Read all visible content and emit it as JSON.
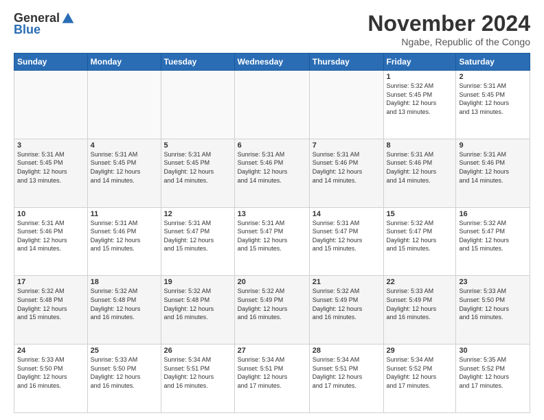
{
  "logo": {
    "general": "General",
    "blue": "Blue"
  },
  "title": "November 2024",
  "location": "Ngabe, Republic of the Congo",
  "days_of_week": [
    "Sunday",
    "Monday",
    "Tuesday",
    "Wednesday",
    "Thursday",
    "Friday",
    "Saturday"
  ],
  "weeks": [
    [
      {
        "day": "",
        "info": ""
      },
      {
        "day": "",
        "info": ""
      },
      {
        "day": "",
        "info": ""
      },
      {
        "day": "",
        "info": ""
      },
      {
        "day": "",
        "info": ""
      },
      {
        "day": "1",
        "info": "Sunrise: 5:32 AM\nSunset: 5:45 PM\nDaylight: 12 hours\nand 13 minutes."
      },
      {
        "day": "2",
        "info": "Sunrise: 5:31 AM\nSunset: 5:45 PM\nDaylight: 12 hours\nand 13 minutes."
      }
    ],
    [
      {
        "day": "3",
        "info": "Sunrise: 5:31 AM\nSunset: 5:45 PM\nDaylight: 12 hours\nand 13 minutes."
      },
      {
        "day": "4",
        "info": "Sunrise: 5:31 AM\nSunset: 5:45 PM\nDaylight: 12 hours\nand 14 minutes."
      },
      {
        "day": "5",
        "info": "Sunrise: 5:31 AM\nSunset: 5:45 PM\nDaylight: 12 hours\nand 14 minutes."
      },
      {
        "day": "6",
        "info": "Sunrise: 5:31 AM\nSunset: 5:46 PM\nDaylight: 12 hours\nand 14 minutes."
      },
      {
        "day": "7",
        "info": "Sunrise: 5:31 AM\nSunset: 5:46 PM\nDaylight: 12 hours\nand 14 minutes."
      },
      {
        "day": "8",
        "info": "Sunrise: 5:31 AM\nSunset: 5:46 PM\nDaylight: 12 hours\nand 14 minutes."
      },
      {
        "day": "9",
        "info": "Sunrise: 5:31 AM\nSunset: 5:46 PM\nDaylight: 12 hours\nand 14 minutes."
      }
    ],
    [
      {
        "day": "10",
        "info": "Sunrise: 5:31 AM\nSunset: 5:46 PM\nDaylight: 12 hours\nand 14 minutes."
      },
      {
        "day": "11",
        "info": "Sunrise: 5:31 AM\nSunset: 5:46 PM\nDaylight: 12 hours\nand 15 minutes."
      },
      {
        "day": "12",
        "info": "Sunrise: 5:31 AM\nSunset: 5:47 PM\nDaylight: 12 hours\nand 15 minutes."
      },
      {
        "day": "13",
        "info": "Sunrise: 5:31 AM\nSunset: 5:47 PM\nDaylight: 12 hours\nand 15 minutes."
      },
      {
        "day": "14",
        "info": "Sunrise: 5:31 AM\nSunset: 5:47 PM\nDaylight: 12 hours\nand 15 minutes."
      },
      {
        "day": "15",
        "info": "Sunrise: 5:32 AM\nSunset: 5:47 PM\nDaylight: 12 hours\nand 15 minutes."
      },
      {
        "day": "16",
        "info": "Sunrise: 5:32 AM\nSunset: 5:47 PM\nDaylight: 12 hours\nand 15 minutes."
      }
    ],
    [
      {
        "day": "17",
        "info": "Sunrise: 5:32 AM\nSunset: 5:48 PM\nDaylight: 12 hours\nand 15 minutes."
      },
      {
        "day": "18",
        "info": "Sunrise: 5:32 AM\nSunset: 5:48 PM\nDaylight: 12 hours\nand 16 minutes."
      },
      {
        "day": "19",
        "info": "Sunrise: 5:32 AM\nSunset: 5:48 PM\nDaylight: 12 hours\nand 16 minutes."
      },
      {
        "day": "20",
        "info": "Sunrise: 5:32 AM\nSunset: 5:49 PM\nDaylight: 12 hours\nand 16 minutes."
      },
      {
        "day": "21",
        "info": "Sunrise: 5:32 AM\nSunset: 5:49 PM\nDaylight: 12 hours\nand 16 minutes."
      },
      {
        "day": "22",
        "info": "Sunrise: 5:33 AM\nSunset: 5:49 PM\nDaylight: 12 hours\nand 16 minutes."
      },
      {
        "day": "23",
        "info": "Sunrise: 5:33 AM\nSunset: 5:50 PM\nDaylight: 12 hours\nand 16 minutes."
      }
    ],
    [
      {
        "day": "24",
        "info": "Sunrise: 5:33 AM\nSunset: 5:50 PM\nDaylight: 12 hours\nand 16 minutes."
      },
      {
        "day": "25",
        "info": "Sunrise: 5:33 AM\nSunset: 5:50 PM\nDaylight: 12 hours\nand 16 minutes."
      },
      {
        "day": "26",
        "info": "Sunrise: 5:34 AM\nSunset: 5:51 PM\nDaylight: 12 hours\nand 16 minutes."
      },
      {
        "day": "27",
        "info": "Sunrise: 5:34 AM\nSunset: 5:51 PM\nDaylight: 12 hours\nand 17 minutes."
      },
      {
        "day": "28",
        "info": "Sunrise: 5:34 AM\nSunset: 5:51 PM\nDaylight: 12 hours\nand 17 minutes."
      },
      {
        "day": "29",
        "info": "Sunrise: 5:34 AM\nSunset: 5:52 PM\nDaylight: 12 hours\nand 17 minutes."
      },
      {
        "day": "30",
        "info": "Sunrise: 5:35 AM\nSunset: 5:52 PM\nDaylight: 12 hours\nand 17 minutes."
      }
    ]
  ]
}
